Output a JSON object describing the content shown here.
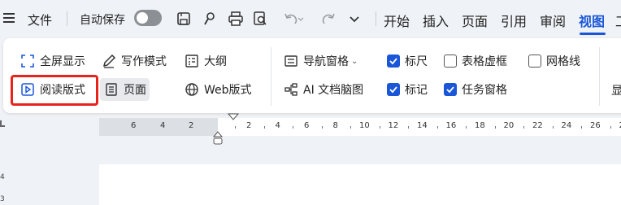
{
  "titlebar": {
    "file_label": "文件",
    "autosave_label": "自动保存",
    "tabs": [
      "开始",
      "插入",
      "页面",
      "引用",
      "审阅",
      "视图",
      "工"
    ]
  },
  "ribbon": {
    "fullscreen": "全屏显示",
    "writing_mode": "写作模式",
    "outline": "大纲",
    "reading_mode": "阅读版式",
    "page_view": "页面",
    "web_view": "Web版式",
    "nav_pane": "导航窗格",
    "ai_mindmap": "AI 文档脑图",
    "ruler": "标尺",
    "table_gridlines": "表格虚框",
    "gridlines": "网格线",
    "marks": "标记",
    "task_pane": "任务窗格",
    "far_right": "显"
  },
  "checkboxes": {
    "ruler": true,
    "table_gridlines": false,
    "gridlines": false,
    "marks": true,
    "task_pane": true
  },
  "ruler": {
    "left_ticks": [
      "6",
      "4",
      "2"
    ],
    "right_ticks": [
      "2",
      "4",
      "6",
      "8",
      "10",
      "12",
      "14",
      "16",
      "18",
      "20",
      "22",
      "24",
      "26",
      "28"
    ]
  },
  "vertical_ruler": [
    "4",
    "3"
  ],
  "colors": {
    "accent": "#1a56d8",
    "highlight": "#e8231c"
  }
}
